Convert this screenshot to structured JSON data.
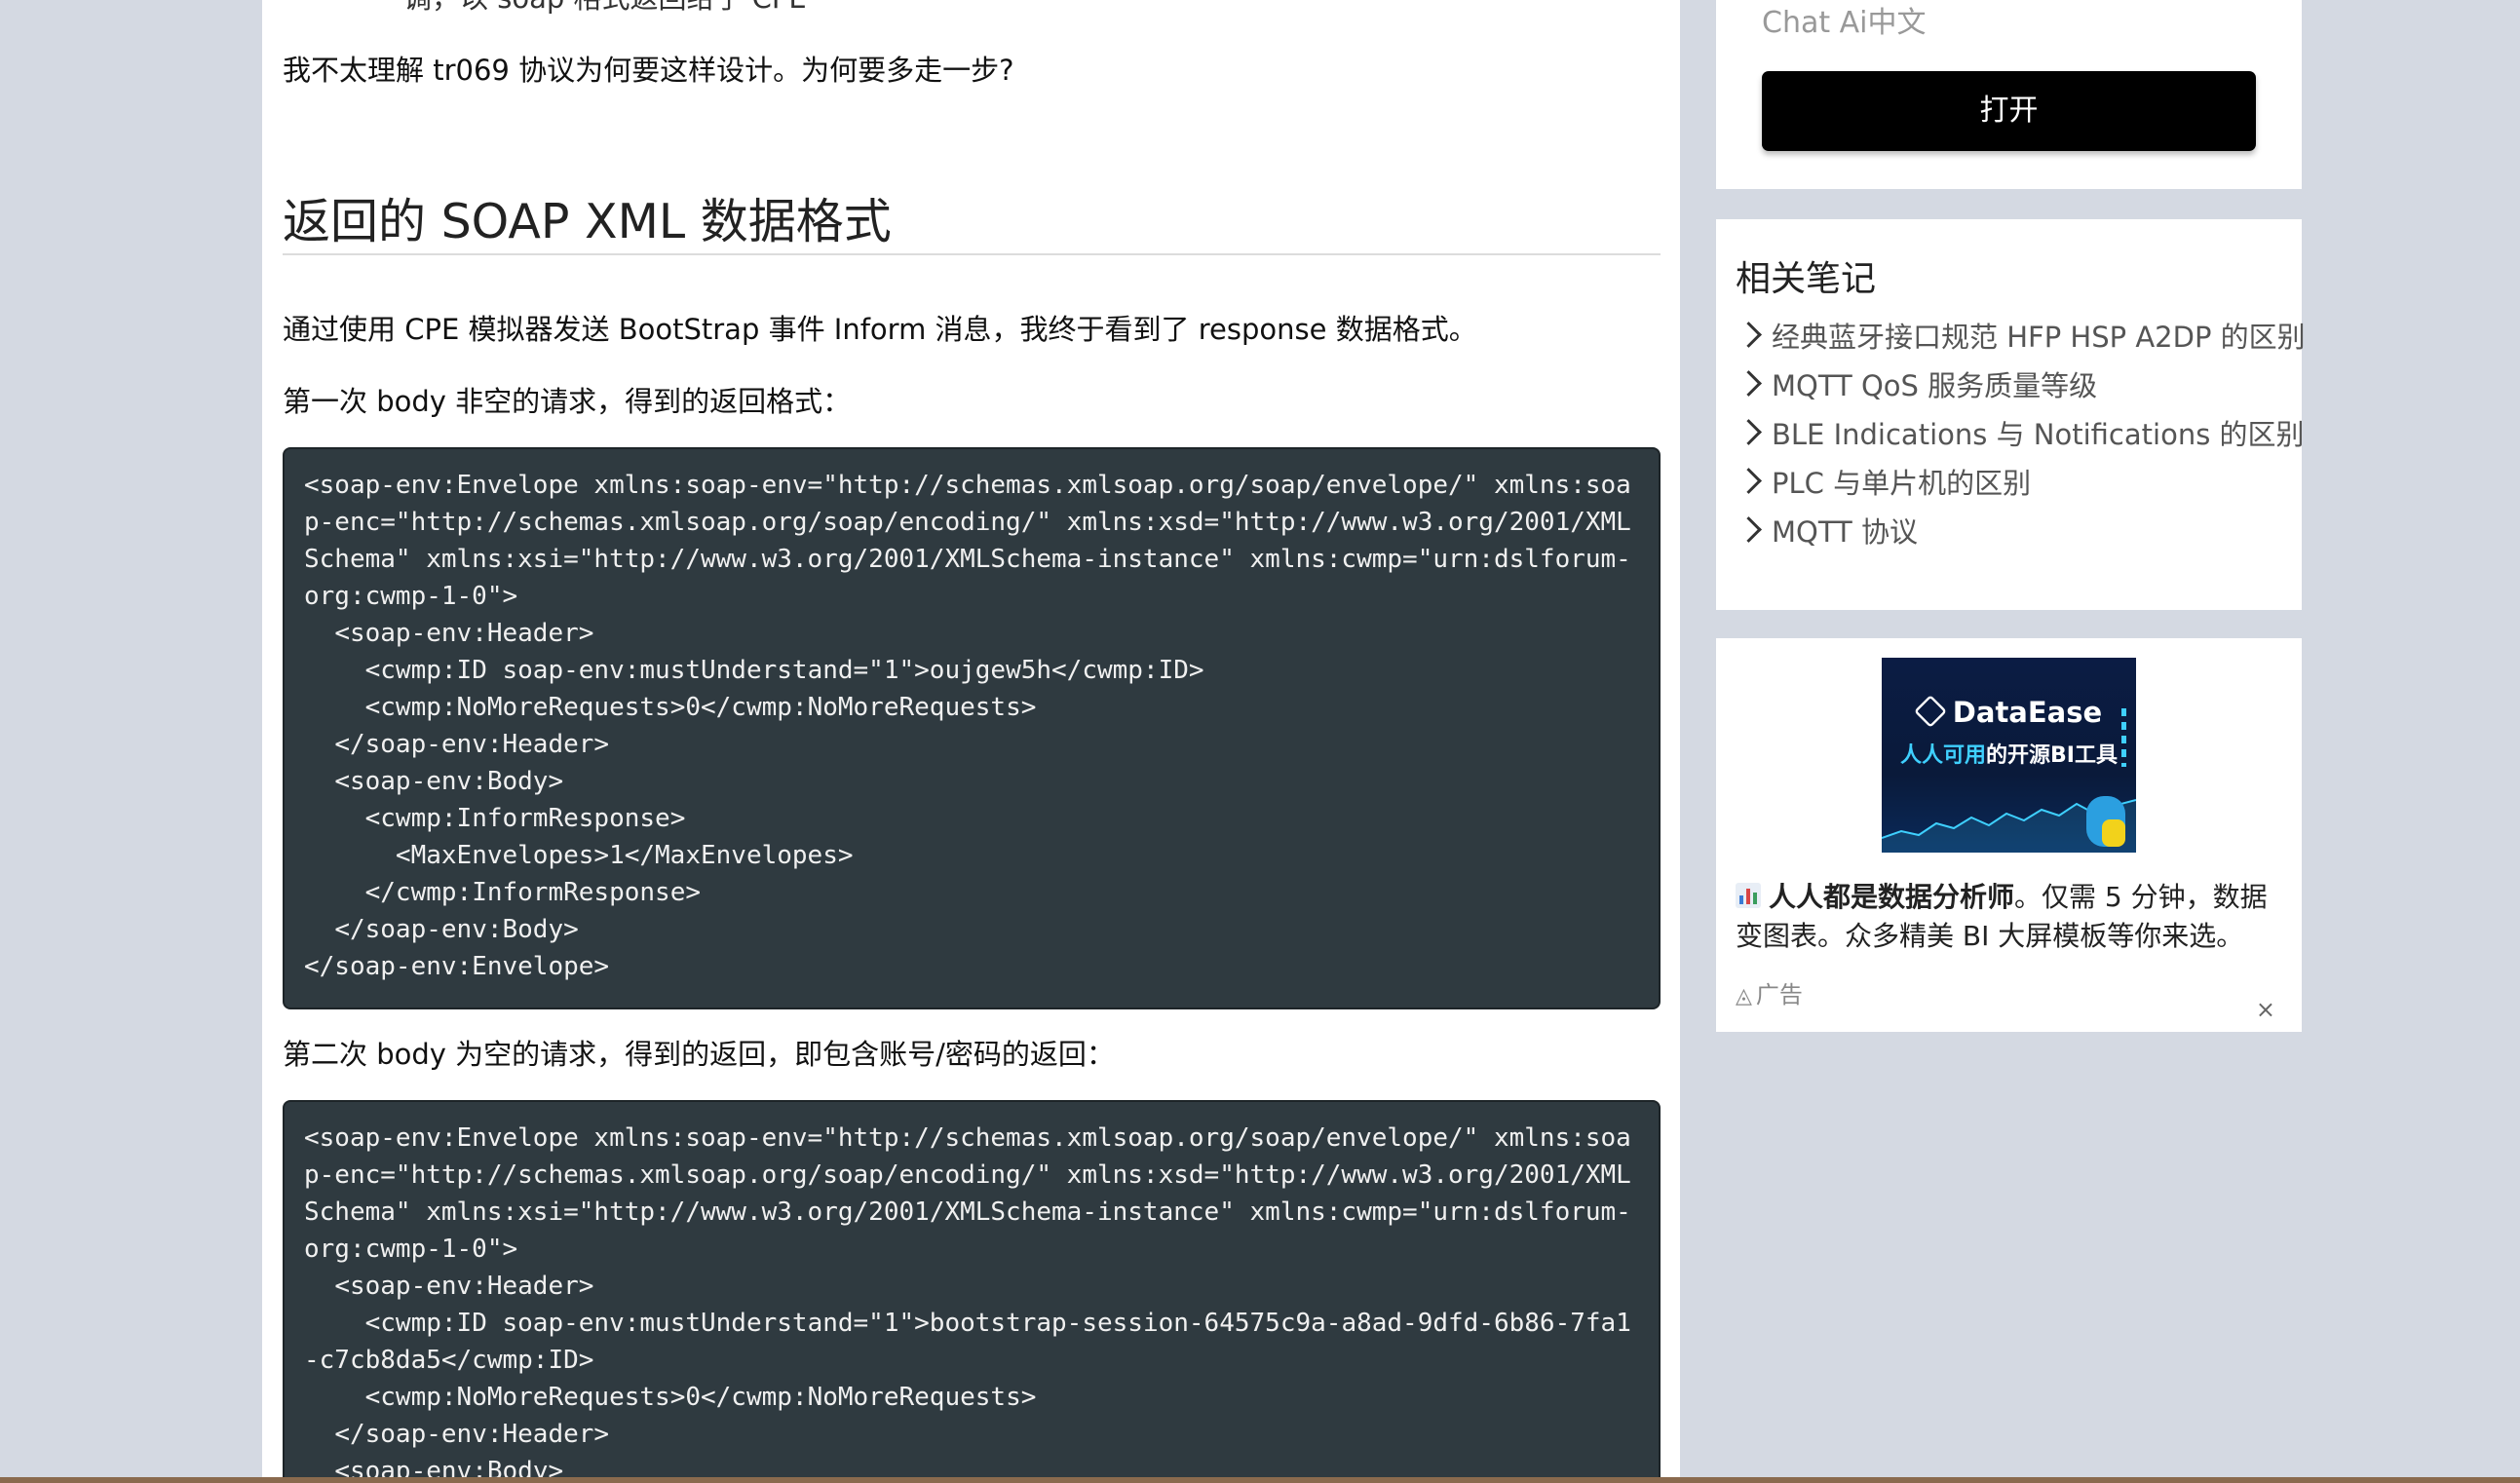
{
  "article": {
    "cut_line": "调，以 soap 格式返回给了 CPE",
    "question": "我不太理解 tr069 协议为何要这样设计。为何要多走一步?",
    "heading": "返回的 SOAP XML 数据格式",
    "intro": "通过使用 CPE 模拟器发送 BootStrap 事件 Inform 消息，我终于看到了 response 数据格式。",
    "first_label": "第一次 body 非空的请求，得到的返回格式：",
    "code_block_1": "<soap-env:Envelope xmlns:soap-env=\"http://schemas.xmlsoap.org/soap/envelope/\" xmlns:soap-enc=\"http://schemas.xmlsoap.org/soap/encoding/\" xmlns:xsd=\"http://www.w3.org/2001/XMLSchema\" xmlns:xsi=\"http://www.w3.org/2001/XMLSchema-instance\" xmlns:cwmp=\"urn:dslforum-org:cwmp-1-0\">\n  <soap-env:Header>\n    <cwmp:ID soap-env:mustUnderstand=\"1\">oujgew5h</cwmp:ID>\n    <cwmp:NoMoreRequests>0</cwmp:NoMoreRequests>\n  </soap-env:Header>\n  <soap-env:Body>\n    <cwmp:InformResponse>\n      <MaxEnvelopes>1</MaxEnvelopes>\n    </cwmp:InformResponse>\n  </soap-env:Body>\n</soap-env:Envelope>",
    "second_label": "第二次 body 为空的请求，得到的返回，即包含账号/密码的返回：",
    "code_block_2": "<soap-env:Envelope xmlns:soap-env=\"http://schemas.xmlsoap.org/soap/envelope/\" xmlns:soap-enc=\"http://schemas.xmlsoap.org/soap/encoding/\" xmlns:xsd=\"http://www.w3.org/2001/XMLSchema\" xmlns:xsi=\"http://www.w3.org/2001/XMLSchema-instance\" xmlns:cwmp=\"urn:dslforum-org:cwmp-1-0\">\n  <soap-env:Header>\n    <cwmp:ID soap-env:mustUnderstand=\"1\">bootstrap-session-64575c9a-a8ad-9dfd-6b86-7fa1-c7cb8da5</cwmp:ID>\n    <cwmp:NoMoreRequests>0</cwmp:NoMoreRequests>\n  </soap-env:Header>\n  <soap-env:Body>"
  },
  "sidebar": {
    "search_text": "Chat Ai中文",
    "open_button": "打开",
    "notes_title": "相关笔记",
    "notes": [
      {
        "label": "经典蓝牙接口规范 HFP HSP A2DP 的区别"
      },
      {
        "label": "MQTT QoS 服务质量等级"
      },
      {
        "label": "BLE Indications 与 Notifications 的区别"
      },
      {
        "label": "PLC 与单片机的区别"
      },
      {
        "label": "MQTT 协议"
      }
    ],
    "ad": {
      "logo_text": "DataEase",
      "slogan_accent": "人人可用",
      "slogan_rest": "的开源BI工具",
      "text_bold": "人人都是数据分析师",
      "text_rest": "。仅需 5 分钟，数据变图表。众多精美 BI 大屏模板等你来选。",
      "label": "广告",
      "close": "×",
      "icon": "bar-chart-icon"
    }
  },
  "colors": {
    "page_background": "#d4d9e2",
    "code_background": "#2f3a40",
    "button_background": "#000000",
    "ad_accent": "#3fd0ff"
  }
}
